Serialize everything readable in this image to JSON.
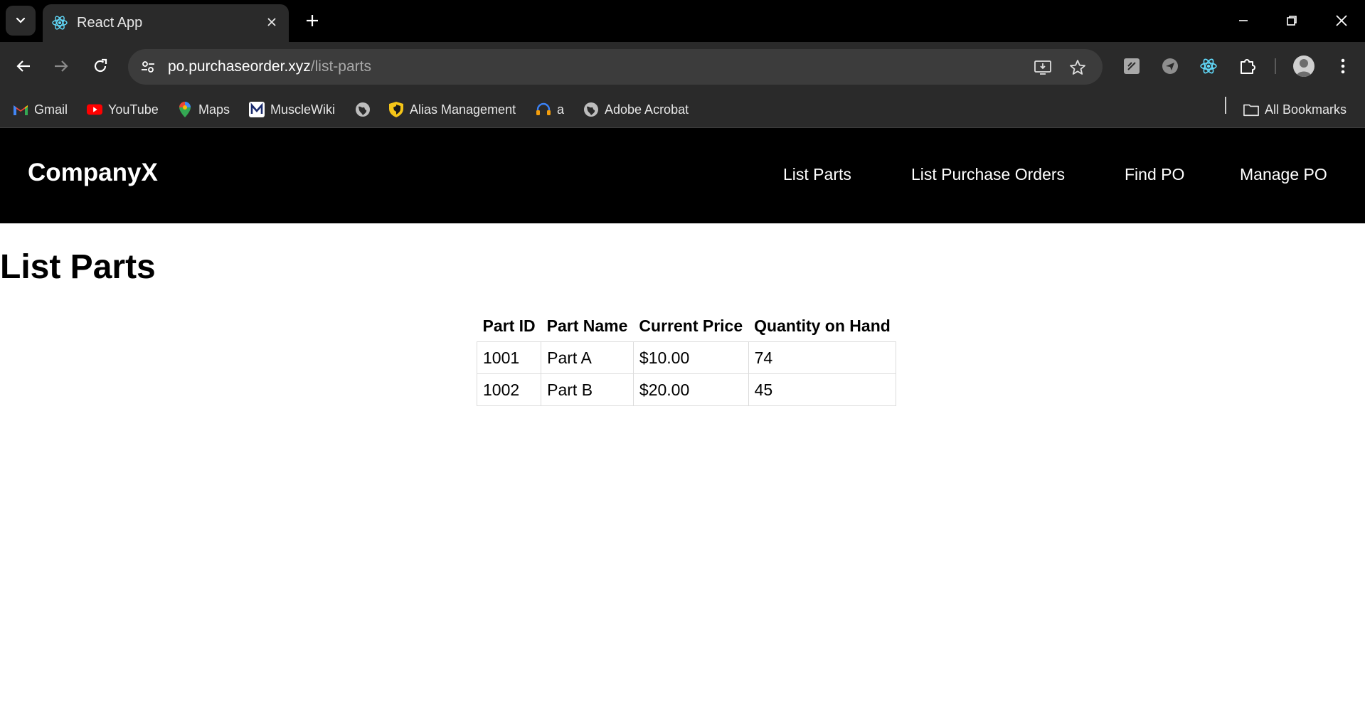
{
  "browser": {
    "tab_title": "React App",
    "url_host": "po.purchaseorder.xyz",
    "url_path": "/list-parts",
    "bookmarks": [
      {
        "label": "Gmail",
        "icon": "gmail-icon"
      },
      {
        "label": "YouTube",
        "icon": "youtube-icon"
      },
      {
        "label": "Maps",
        "icon": "maps-icon"
      },
      {
        "label": "MuscleWiki",
        "icon": "musclewiki-icon"
      },
      {
        "label": "",
        "icon": "globe-icon"
      },
      {
        "label": "Alias Management",
        "icon": "shield-icon"
      },
      {
        "label": "a",
        "icon": "headset-icon"
      },
      {
        "label": "Adobe Acrobat",
        "icon": "globe-icon"
      }
    ],
    "all_bookmarks_label": "All Bookmarks",
    "colors": {
      "chrome_bg": "#000000",
      "toolbar_bg": "#2a2a2a",
      "omnibox_bg": "#3c3c3c",
      "react_blue": "#61dafb"
    }
  },
  "app": {
    "brand": "CompanyX",
    "nav": [
      "List Parts",
      "List Purchase Orders",
      "Find PO",
      "Manage PO"
    ],
    "page_title": "List Parts",
    "table": {
      "headers": [
        "Part ID",
        "Part Name",
        "Current Price",
        "Quantity on Hand"
      ],
      "rows": [
        [
          "1001",
          "Part A",
          "$10.00",
          "74"
        ],
        [
          "1002",
          "Part B",
          "$20.00",
          "45"
        ]
      ]
    }
  }
}
